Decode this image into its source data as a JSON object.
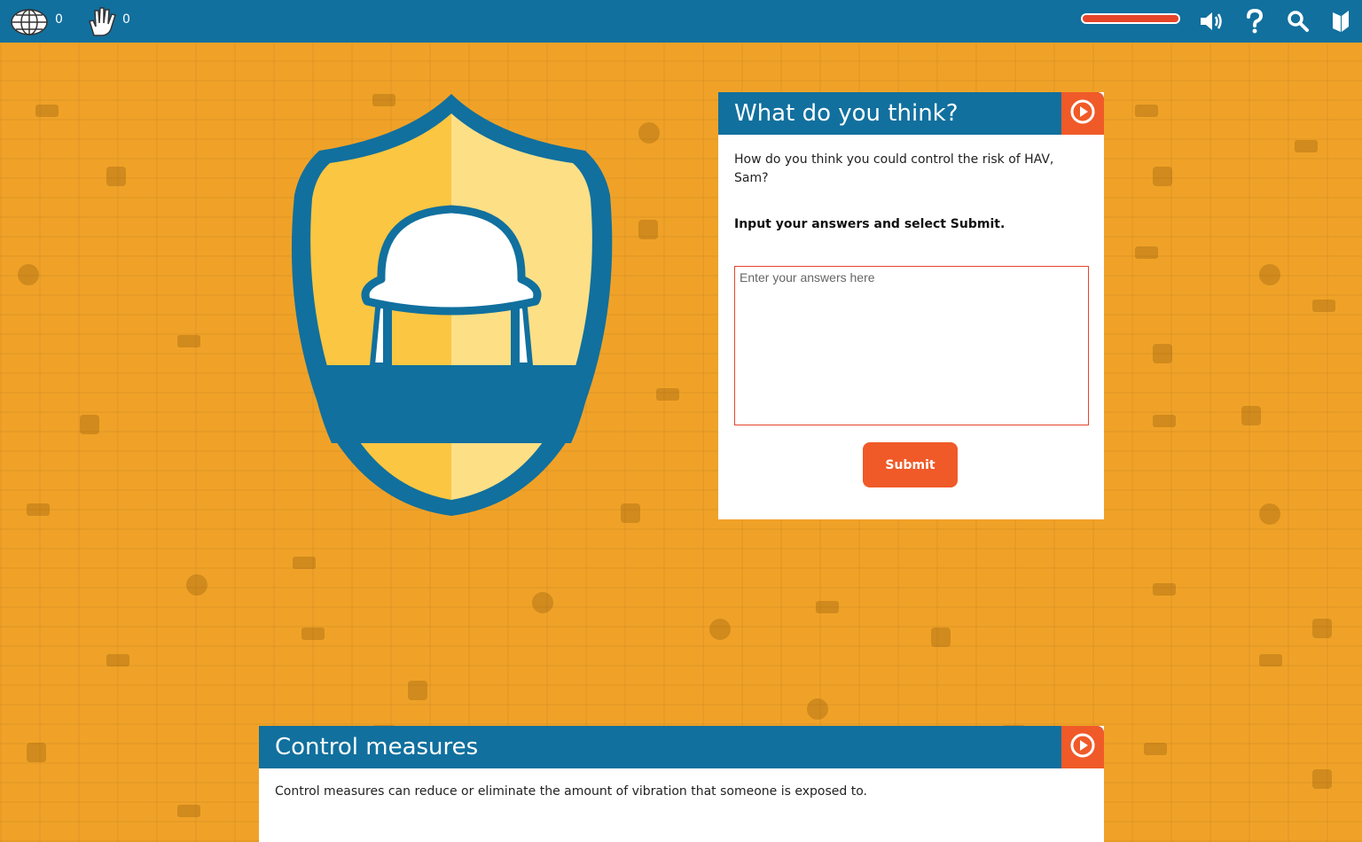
{
  "topbar": {
    "globe_count": "0",
    "hand_count": "0",
    "progress": 1.0,
    "icons": [
      "globe-icon",
      "hand-icon",
      "volume-icon",
      "help-icon",
      "search-icon",
      "book-icon"
    ]
  },
  "question_panel": {
    "title": "What do you think?",
    "question": "How do you think you could control the risk of HAV, Sam?",
    "instruction": "Input your answers and select Submit.",
    "input_placeholder": "Enter your answers here",
    "submit_label": "Submit"
  },
  "control_panel": {
    "title": "Control measures",
    "text": "Control measures can reduce or eliminate the amount of vibration that someone is exposed to."
  },
  "colors": {
    "bar": "#11709e",
    "accent": "#f05a28",
    "background": "#f0a228",
    "shield_yellow": "#fbc642",
    "shield_light": "#fddf86"
  }
}
